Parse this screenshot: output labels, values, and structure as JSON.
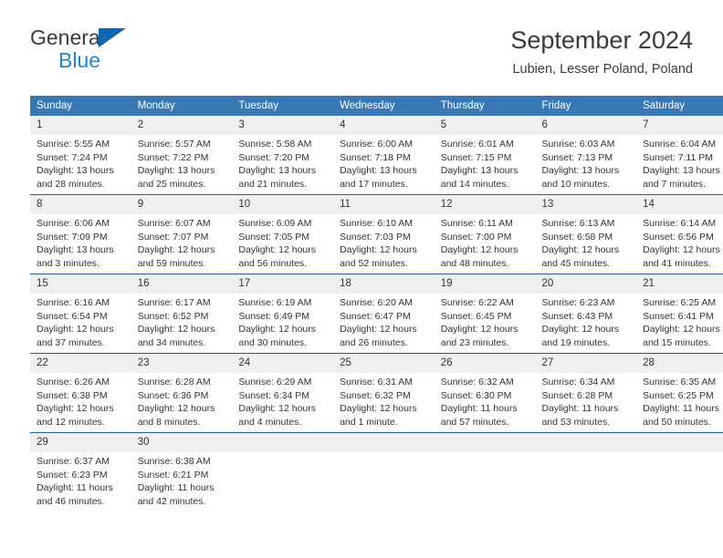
{
  "brand": {
    "name_top": "General",
    "name_bottom": "Blue",
    "logo_icon": "blue-triangle-mark",
    "color_dark": "#3b3b3b",
    "color_blue": "#1b87d6"
  },
  "header": {
    "title": "September 2024",
    "subtitle": "Lubien, Lesser Poland, Poland"
  },
  "theme": {
    "header_bg": "#3878b5",
    "header_text": "#ffffff",
    "row_divider": "#1f5fa0",
    "daynum_bg": "#f0f0f0",
    "body_text": "#333333"
  },
  "calendar": {
    "weekday_headers": [
      "Sunday",
      "Monday",
      "Tuesday",
      "Wednesday",
      "Thursday",
      "Friday",
      "Saturday"
    ],
    "weeks": [
      [
        {
          "day": "1",
          "sunrise": "Sunrise: 5:55 AM",
          "sunset": "Sunset: 7:24 PM",
          "daylight_1": "Daylight: 13 hours",
          "daylight_2": "and 28 minutes."
        },
        {
          "day": "2",
          "sunrise": "Sunrise: 5:57 AM",
          "sunset": "Sunset: 7:22 PM",
          "daylight_1": "Daylight: 13 hours",
          "daylight_2": "and 25 minutes."
        },
        {
          "day": "3",
          "sunrise": "Sunrise: 5:58 AM",
          "sunset": "Sunset: 7:20 PM",
          "daylight_1": "Daylight: 13 hours",
          "daylight_2": "and 21 minutes."
        },
        {
          "day": "4",
          "sunrise": "Sunrise: 6:00 AM",
          "sunset": "Sunset: 7:18 PM",
          "daylight_1": "Daylight: 13 hours",
          "daylight_2": "and 17 minutes."
        },
        {
          "day": "5",
          "sunrise": "Sunrise: 6:01 AM",
          "sunset": "Sunset: 7:15 PM",
          "daylight_1": "Daylight: 13 hours",
          "daylight_2": "and 14 minutes."
        },
        {
          "day": "6",
          "sunrise": "Sunrise: 6:03 AM",
          "sunset": "Sunset: 7:13 PM",
          "daylight_1": "Daylight: 13 hours",
          "daylight_2": "and 10 minutes."
        },
        {
          "day": "7",
          "sunrise": "Sunrise: 6:04 AM",
          "sunset": "Sunset: 7:11 PM",
          "daylight_1": "Daylight: 13 hours",
          "daylight_2": "and 7 minutes."
        }
      ],
      [
        {
          "day": "8",
          "sunrise": "Sunrise: 6:06 AM",
          "sunset": "Sunset: 7:09 PM",
          "daylight_1": "Daylight: 13 hours",
          "daylight_2": "and 3 minutes."
        },
        {
          "day": "9",
          "sunrise": "Sunrise: 6:07 AM",
          "sunset": "Sunset: 7:07 PM",
          "daylight_1": "Daylight: 12 hours",
          "daylight_2": "and 59 minutes."
        },
        {
          "day": "10",
          "sunrise": "Sunrise: 6:09 AM",
          "sunset": "Sunset: 7:05 PM",
          "daylight_1": "Daylight: 12 hours",
          "daylight_2": "and 56 minutes."
        },
        {
          "day": "11",
          "sunrise": "Sunrise: 6:10 AM",
          "sunset": "Sunset: 7:03 PM",
          "daylight_1": "Daylight: 12 hours",
          "daylight_2": "and 52 minutes."
        },
        {
          "day": "12",
          "sunrise": "Sunrise: 6:11 AM",
          "sunset": "Sunset: 7:00 PM",
          "daylight_1": "Daylight: 12 hours",
          "daylight_2": "and 48 minutes."
        },
        {
          "day": "13",
          "sunrise": "Sunrise: 6:13 AM",
          "sunset": "Sunset: 6:58 PM",
          "daylight_1": "Daylight: 12 hours",
          "daylight_2": "and 45 minutes."
        },
        {
          "day": "14",
          "sunrise": "Sunrise: 6:14 AM",
          "sunset": "Sunset: 6:56 PM",
          "daylight_1": "Daylight: 12 hours",
          "daylight_2": "and 41 minutes."
        }
      ],
      [
        {
          "day": "15",
          "sunrise": "Sunrise: 6:16 AM",
          "sunset": "Sunset: 6:54 PM",
          "daylight_1": "Daylight: 12 hours",
          "daylight_2": "and 37 minutes."
        },
        {
          "day": "16",
          "sunrise": "Sunrise: 6:17 AM",
          "sunset": "Sunset: 6:52 PM",
          "daylight_1": "Daylight: 12 hours",
          "daylight_2": "and 34 minutes."
        },
        {
          "day": "17",
          "sunrise": "Sunrise: 6:19 AM",
          "sunset": "Sunset: 6:49 PM",
          "daylight_1": "Daylight: 12 hours",
          "daylight_2": "and 30 minutes."
        },
        {
          "day": "18",
          "sunrise": "Sunrise: 6:20 AM",
          "sunset": "Sunset: 6:47 PM",
          "daylight_1": "Daylight: 12 hours",
          "daylight_2": "and 26 minutes."
        },
        {
          "day": "19",
          "sunrise": "Sunrise: 6:22 AM",
          "sunset": "Sunset: 6:45 PM",
          "daylight_1": "Daylight: 12 hours",
          "daylight_2": "and 23 minutes."
        },
        {
          "day": "20",
          "sunrise": "Sunrise: 6:23 AM",
          "sunset": "Sunset: 6:43 PM",
          "daylight_1": "Daylight: 12 hours",
          "daylight_2": "and 19 minutes."
        },
        {
          "day": "21",
          "sunrise": "Sunrise: 6:25 AM",
          "sunset": "Sunset: 6:41 PM",
          "daylight_1": "Daylight: 12 hours",
          "daylight_2": "and 15 minutes."
        }
      ],
      [
        {
          "day": "22",
          "sunrise": "Sunrise: 6:26 AM",
          "sunset": "Sunset: 6:38 PM",
          "daylight_1": "Daylight: 12 hours",
          "daylight_2": "and 12 minutes."
        },
        {
          "day": "23",
          "sunrise": "Sunrise: 6:28 AM",
          "sunset": "Sunset: 6:36 PM",
          "daylight_1": "Daylight: 12 hours",
          "daylight_2": "and 8 minutes."
        },
        {
          "day": "24",
          "sunrise": "Sunrise: 6:29 AM",
          "sunset": "Sunset: 6:34 PM",
          "daylight_1": "Daylight: 12 hours",
          "daylight_2": "and 4 minutes."
        },
        {
          "day": "25",
          "sunrise": "Sunrise: 6:31 AM",
          "sunset": "Sunset: 6:32 PM",
          "daylight_1": "Daylight: 12 hours",
          "daylight_2": "and 1 minute."
        },
        {
          "day": "26",
          "sunrise": "Sunrise: 6:32 AM",
          "sunset": "Sunset: 6:30 PM",
          "daylight_1": "Daylight: 11 hours",
          "daylight_2": "and 57 minutes."
        },
        {
          "day": "27",
          "sunrise": "Sunrise: 6:34 AM",
          "sunset": "Sunset: 6:28 PM",
          "daylight_1": "Daylight: 11 hours",
          "daylight_2": "and 53 minutes."
        },
        {
          "day": "28",
          "sunrise": "Sunrise: 6:35 AM",
          "sunset": "Sunset: 6:25 PM",
          "daylight_1": "Daylight: 11 hours",
          "daylight_2": "and 50 minutes."
        }
      ],
      [
        {
          "day": "29",
          "sunrise": "Sunrise: 6:37 AM",
          "sunset": "Sunset: 6:23 PM",
          "daylight_1": "Daylight: 11 hours",
          "daylight_2": "and 46 minutes."
        },
        {
          "day": "30",
          "sunrise": "Sunrise: 6:38 AM",
          "sunset": "Sunset: 6:21 PM",
          "daylight_1": "Daylight: 11 hours",
          "daylight_2": "and 42 minutes."
        },
        {
          "day": "",
          "sunrise": "",
          "sunset": "",
          "daylight_1": "",
          "daylight_2": ""
        },
        {
          "day": "",
          "sunrise": "",
          "sunset": "",
          "daylight_1": "",
          "daylight_2": ""
        },
        {
          "day": "",
          "sunrise": "",
          "sunset": "",
          "daylight_1": "",
          "daylight_2": ""
        },
        {
          "day": "",
          "sunrise": "",
          "sunset": "",
          "daylight_1": "",
          "daylight_2": ""
        },
        {
          "day": "",
          "sunrise": "",
          "sunset": "",
          "daylight_1": "",
          "daylight_2": ""
        }
      ]
    ]
  }
}
